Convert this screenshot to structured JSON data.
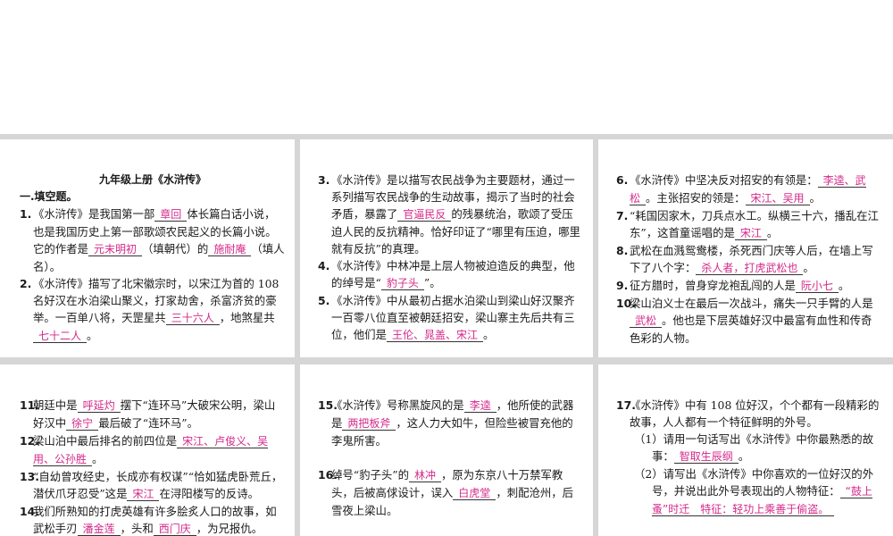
{
  "doc_title": "九年级上册《水浒传》",
  "section_title": "一.填空题。",
  "q1": {
    "num": "1.",
    "t1": "《水浒传》是我国第一部",
    "a1": "章回",
    "t2": "体长篇白话小说，也是我国历史上第一部歌颂农民起义的长篇小说。它的作者是",
    "a2": "元末明初",
    "t3": "（填朝代）的",
    "a3": "施耐庵",
    "t4": "（填人名）。"
  },
  "q2": {
    "num": "2.",
    "t1": "《水浒传》描写了北宋徽宗时，以宋江为首的 108 名好汉在水泊梁山聚义，打家劫舍，杀富济贫的豪举。一百单八将，天罡星共",
    "a1": "三十六人",
    "t2": "，地煞星共",
    "a2": "七十二人",
    "t3": "。"
  },
  "q3": {
    "num": "3.",
    "t1": "《水浒传》是以描写农民战争为主要题材，通过一系列描写农民战争的生动故事，揭示了当时的社会矛盾，暴露了",
    "a1": "官逼民反",
    "t2": "的残暴统治，歌颂了受压迫人民的反抗精神。恰好印证了“哪里有压迫，哪里就有反抗”的真理。"
  },
  "q4": {
    "num": "4.",
    "t1": "《水浒传》中林冲是上层人物被迫造反的典型，他的绰号是“",
    "a1": "豹子头",
    "t2": "”。"
  },
  "q5": {
    "num": "5.",
    "t1": "《水浒传》中从最初占据水泊梁山到梁山好汉聚齐一百零八位直至被朝廷招安，梁山寨主先后共有三位，他们是",
    "a1": "王伦、晁盖、宋江",
    "t2": "。"
  },
  "q6": {
    "num": "6.",
    "t1": "《水浒传》中坚决反对招安的有领是：",
    "a1": "李逵、武松",
    "t2": "。主张招安的领是：",
    "a2": "宋江、吴用",
    "t3": "。"
  },
  "q7": {
    "num": "7.",
    "t1": "“耗国因家木，刀兵点水工。纵横三十六，播乱在江东”，这首童谣唱的是",
    "a1": "宋江",
    "t2": "。"
  },
  "q8": {
    "num": "8.",
    "t1": "武松在血溅鸳鸯楼，杀死西门庆等人后，在墙上写下了八个字：",
    "a1": "杀人者，打虎武松也",
    "t2": "。"
  },
  "q9": {
    "num": "9.",
    "t1": "征方腊时，曾身穿龙袍乱闯的人是",
    "a1": "阮小七",
    "t2": "。"
  },
  "q10": {
    "num": "10.",
    "t1": "梁山泊义士在最后一次战斗，痛失一只手臂的人是",
    "a1": "武松",
    "t2": "。他也是下层英雄好汉中最富有血性和传奇色彩的人物。"
  },
  "q11": {
    "num": "11.",
    "t1": "朝廷中是",
    "a1": "呼延灼",
    "t2": "摆下“连环马”大破宋公明，梁山好汉中",
    "a2": "徐宁",
    "t3": "最后破了“连环马”。"
  },
  "q12": {
    "num": "12.",
    "t1": "梁山泊中最后排名的前四位是",
    "a1": "宋江、卢俊义、吴用、公孙胜",
    "t2": "。"
  },
  "q13": {
    "num": "13.",
    "t1": "“自幼曾攻经史，长成亦有权谋”“恰如猛虎卧荒丘，潜伏爪牙忍受”这是",
    "a1": "宋江",
    "t2": "在浔阳楼写的反诗。"
  },
  "q14": {
    "num": "14.",
    "t1": "我们所熟知的打虎英雄有许多脍炙人口的故事，如武松手刃",
    "a1": "潘金莲",
    "t2": "，头和",
    "a2": "西门庆",
    "t3": "，为兄报仇。"
  },
  "q15": {
    "num": "15.",
    "t1": "《水浒传》号称黑旋风的是",
    "a1": "李逵",
    "t2": "，他所使的武器是",
    "a2": "两把板斧",
    "t3": "，这人力大如牛，但险些被冒充他的李鬼所害。"
  },
  "q16": {
    "num": "16.",
    "t1": "绰号“豹子头”的",
    "a1": "林冲",
    "t2": "，原为东京八十万禁军教头，后被高俅设计，误入",
    "a2": "白虎堂",
    "t3": "，刺配沧州，后雪夜上梁山。"
  },
  "q17": {
    "num": "17.",
    "t1": "《水浒传》中有 108 位好汉，个个都有一段精彩的故事，人人都有一个特征鲜明的外号。",
    "s1": "（1）请用一句话写出《水浒传》中你最熟悉的故事：",
    "s1a": "智取生辰纲",
    "s1e": "。",
    "s2": "（2）请写出《水浒传》中你喜欢的一位好汉的外号，并说出此外号表现出的人物特征：",
    "s2a": "“鼓上蚤”时迁　特征：轻功上乘善于偷盗。"
  },
  "colors": {
    "answer": "#d4298a",
    "divider": "#d6d6d6",
    "text": "#1a1a1a"
  }
}
